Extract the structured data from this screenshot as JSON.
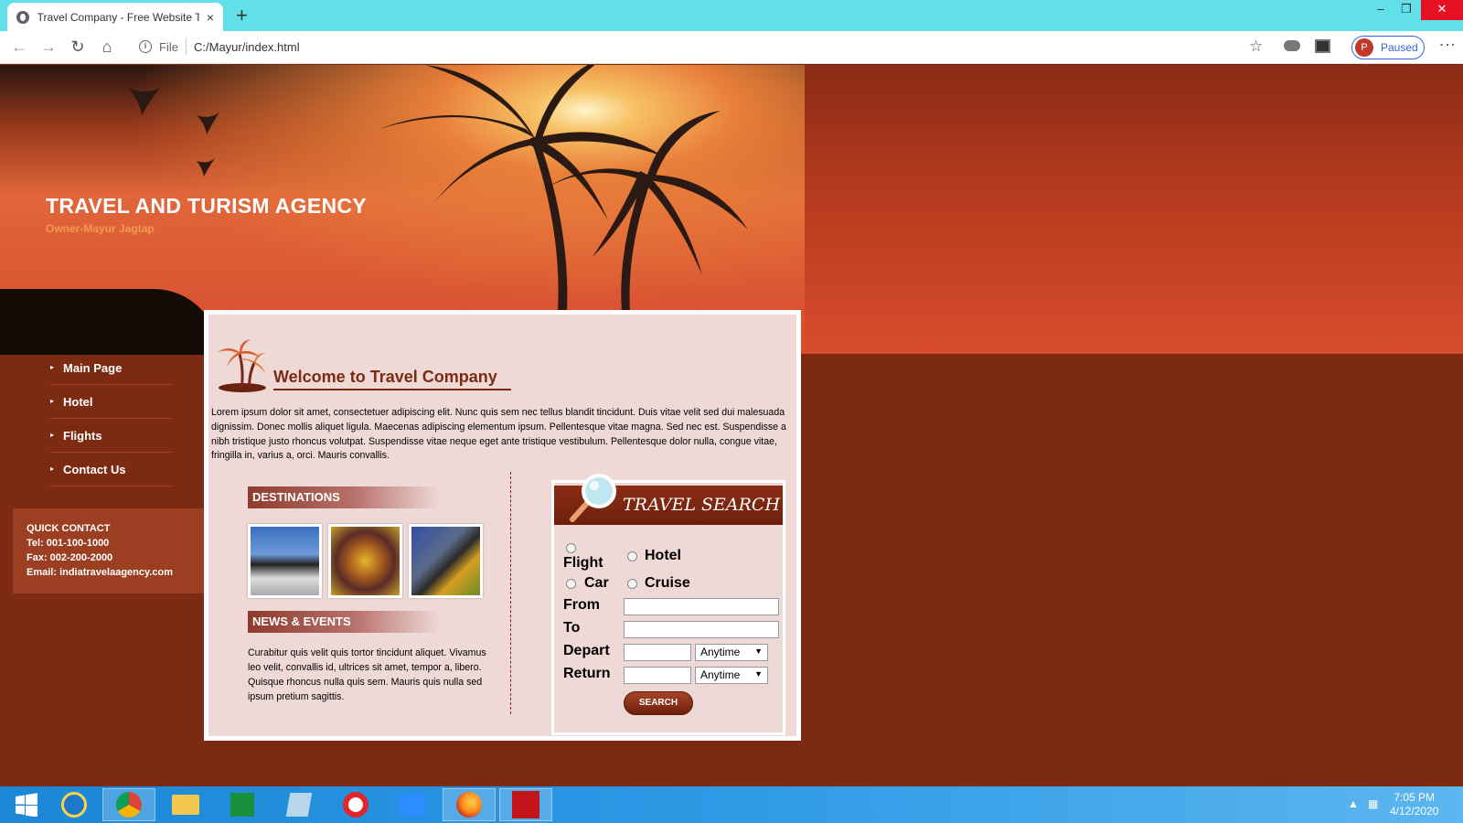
{
  "browser": {
    "tab_title": "Travel Company - Free Website T",
    "tab_close": "×",
    "new_tab": "+",
    "url_scheme": "File",
    "url": "C:/Mayur/index.html",
    "profile_initial": "P",
    "profile_status": "Paused",
    "window_controls": {
      "minimize": "–",
      "restore": "❐",
      "close": "✕"
    },
    "nav_icons": {
      "back": "←",
      "forward": "→",
      "reload": "↻",
      "home": "⌂",
      "bookmark": "☆",
      "menu": "⋮"
    }
  },
  "header": {
    "title": "TRAVEL AND TURISM AGENCY",
    "owner": "Owner-Mayur Jagtap"
  },
  "sidebar": {
    "items": [
      {
        "label": "Main Page"
      },
      {
        "label": "Hotel"
      },
      {
        "label": "Flights"
      },
      {
        "label": "Contact Us"
      }
    ]
  },
  "quick_contact": {
    "title": "QUICK CONTACT",
    "tel": "Tel: 001-100-1000",
    "fax": "Fax: 002-200-2000",
    "email": "Email: indiatravelaagency.com"
  },
  "main": {
    "welcome": "Welcome to Travel Company",
    "intro": "Lorem ipsum dolor sit amet, consectetuer adipiscing elit. Nunc quis sem nec tellus blandit tincidunt. Duis vitae velit sed dui malesuada dignissim. Donec mollis aliquet ligula. Maecenas adipiscing elementum ipsum. Pellentesque vitae magna. Sed nec est. Suspendisse a nibh tristique justo rhoncus volutpat. Suspendisse vitae neque eget ante tristique vestibulum. Pellentesque dolor nulla, congue vitae, fringilla in, varius a, orci. Mauris convallis.",
    "destinations_title": "DESTINATIONS",
    "news_title": "NEWS & EVENTS",
    "news_text": "Curabitur quis velit quis tortor tincidunt aliquet. Vivamus leo velit, convallis id, ultrices sit amet, tempor a, libero. Quisque rhoncus nulla quis sem. Mauris quis nulla sed ipsum pretium sagittis."
  },
  "travel_search": {
    "title": "TRAVEL SEARCH",
    "options": {
      "flight": "Flight",
      "hotel": "Hotel",
      "car": "Car",
      "cruise": "Cruise"
    },
    "from_label": "From",
    "to_label": "To",
    "depart_label": "Depart",
    "return_label": "Return",
    "depart_time": "Anytime",
    "return_time": "Anytime",
    "button": "SEARCH"
  },
  "taskbar": {
    "time": "7:05 PM",
    "date": "4/12/2020"
  }
}
